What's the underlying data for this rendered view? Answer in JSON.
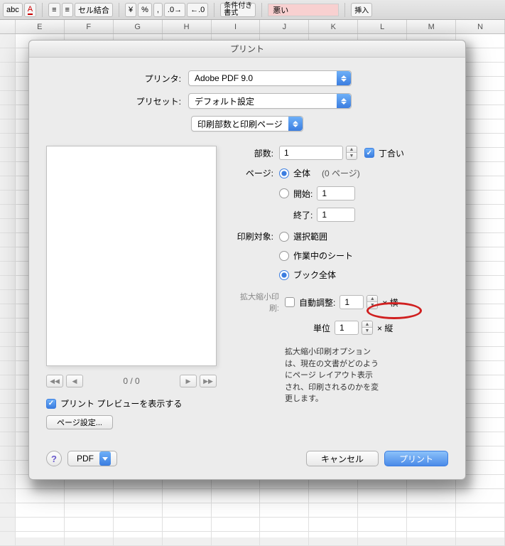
{
  "toolbar": {
    "merge_label": "セル結合",
    "cond_format_label": "条件付き\n書式",
    "bad_style": "悪い",
    "insert_label": "挿入"
  },
  "columns": [
    "E",
    "F",
    "G",
    "H",
    "I",
    "J",
    "K",
    "L",
    "M",
    "N"
  ],
  "dialog": {
    "title": "プリント",
    "printer_label": "プリンタ:",
    "printer_value": "Adobe PDF 9.0",
    "preset_label": "プリセット:",
    "preset_value": "デフォルト設定",
    "section_value": "印刷部数と印刷ページ",
    "copies_label": "部数:",
    "copies_value": "1",
    "collate_label": "丁合い",
    "pages_label": "ページ:",
    "pages_all": "全体",
    "pages_count": "(0 ページ)",
    "pages_from_label": "開始:",
    "pages_from_value": "1",
    "pages_to_label": "終了:",
    "pages_to_value": "1",
    "target_label": "印刷対象:",
    "target_selection": "選択範囲",
    "target_active": "作業中のシート",
    "target_book": "ブック全体",
    "scale_label": "拡大縮小印刷:",
    "auto_fit": "自動調整:",
    "auto_fit_value": "1",
    "by_pages": "× 横",
    "unit_label": "単位",
    "unit_value": "1",
    "by_tall": "× 縦",
    "scale_note": "拡大縮小印刷オプションは、現在の文書がどのようにページ レイアウト表示され、印刷されるのかを変更します。",
    "pager_text": "0 / 0",
    "show_preview": "プリント プレビューを表示する",
    "page_setup_btn": "ページ設定...",
    "help": "?",
    "pdf_btn": "PDF",
    "cancel": "キャンセル",
    "print": "プリント"
  }
}
